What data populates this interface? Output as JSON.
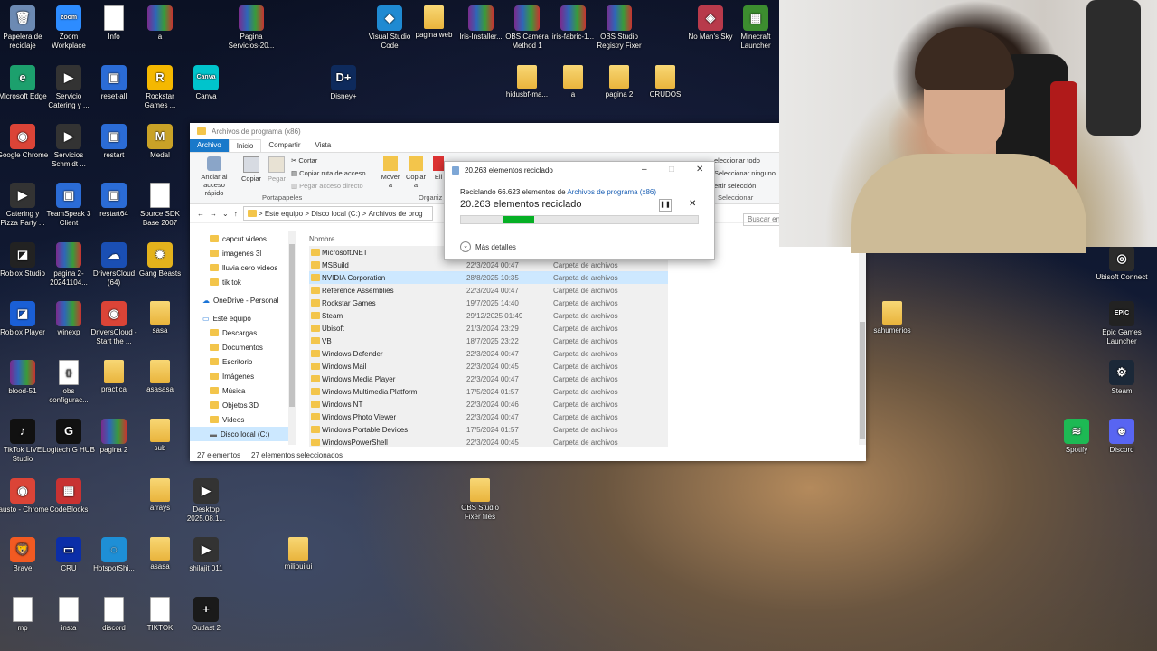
{
  "desktop_icons": [
    {
      "label": "Papelera de reciclaje",
      "glyph": "🗑",
      "kind": "app",
      "color": "#6c8ab3"
    },
    {
      "label": "Zoom Workplace",
      "glyph": "zoom",
      "kind": "app",
      "color": "#2d8cff"
    },
    {
      "label": "Info",
      "glyph": "",
      "kind": "doc",
      "color": "#ffffff"
    },
    {
      "label": "a",
      "glyph": "",
      "kind": "rar",
      "color": ""
    },
    {
      "label": "Pagina Servicios-20...",
      "glyph": "",
      "kind": "rar",
      "color": ""
    },
    {
      "label": "Visual Studio Code",
      "glyph": "◆",
      "kind": "app",
      "color": "#1f8ad2"
    },
    {
      "label": "pagina web",
      "glyph": "",
      "kind": "folder",
      "color": ""
    },
    {
      "label": "Iris-Installer...",
      "glyph": "",
      "kind": "rar",
      "color": ""
    },
    {
      "label": "OBS Camera Method 1",
      "glyph": "",
      "kind": "rar",
      "color": ""
    },
    {
      "label": "iris-fabric-1...",
      "glyph": "",
      "kind": "rar",
      "color": ""
    },
    {
      "label": "OBS Studio Registry Fixer",
      "glyph": "",
      "kind": "rar",
      "color": ""
    },
    {
      "label": "No Man's Sky",
      "glyph": "◈",
      "kind": "app",
      "color": "#b83a4b"
    },
    {
      "label": "Minecraft Launcher",
      "glyph": "▦",
      "kind": "app",
      "color": "#3c8d2f"
    },
    {
      "label": "Microsoft Edge",
      "glyph": "e",
      "kind": "app",
      "color": "#1ca06d"
    },
    {
      "label": "Servicio Catering y ...",
      "glyph": "▶",
      "kind": "app",
      "color": "#333333"
    },
    {
      "label": "reset-all",
      "glyph": "▣",
      "kind": "app",
      "color": "#2b6cd6"
    },
    {
      "label": "Rockstar Games ...",
      "glyph": "R",
      "kind": "app",
      "color": "#f5b800"
    },
    {
      "label": "Canva",
      "glyph": "Canva",
      "kind": "app",
      "color": "#00c4cc"
    },
    {
      "label": "Disney+",
      "glyph": "D+",
      "kind": "app",
      "color": "#0e2a5c"
    },
    {
      "label": "hidusbf-ma...",
      "glyph": "",
      "kind": "folder",
      "color": ""
    },
    {
      "label": "a",
      "glyph": "",
      "kind": "folder",
      "color": ""
    },
    {
      "label": "pagina 2",
      "glyph": "",
      "kind": "folder",
      "color": ""
    },
    {
      "label": "CRUDOS",
      "glyph": "",
      "kind": "folder",
      "color": ""
    },
    {
      "label": "Google Chrome",
      "glyph": "◉",
      "kind": "app",
      "color": "#db4437"
    },
    {
      "label": "Servicios Schmidt ...",
      "glyph": "▶",
      "kind": "app",
      "color": "#333333"
    },
    {
      "label": "restart",
      "glyph": "▣",
      "kind": "app",
      "color": "#2b6cd6"
    },
    {
      "label": "Medal",
      "glyph": "M",
      "kind": "app",
      "color": "#c9a227"
    },
    {
      "label": "Catering y Pizza Party ...",
      "glyph": "▶",
      "kind": "app",
      "color": "#333333"
    },
    {
      "label": "TeamSpeak 3 Client",
      "glyph": "▣",
      "kind": "app",
      "color": "#2b6cd6"
    },
    {
      "label": "restart64",
      "glyph": "▣",
      "kind": "app",
      "color": "#2b6cd6"
    },
    {
      "label": "Source SDK Base 2007",
      "glyph": "",
      "kind": "doc",
      "color": ""
    },
    {
      "label": "Roblox Studio",
      "glyph": "◪",
      "kind": "app",
      "color": "#222222"
    },
    {
      "label": "pagina 2-20241104...",
      "glyph": "",
      "kind": "rar",
      "color": ""
    },
    {
      "label": "DriversCloud (64)",
      "glyph": "☁",
      "kind": "app",
      "color": "#1a4fb4"
    },
    {
      "label": "Gang Beasts",
      "glyph": "✹",
      "kind": "app",
      "color": "#e3b21c"
    },
    {
      "label": "Roblox Player",
      "glyph": "◪",
      "kind": "app",
      "color": "#1a5fd6"
    },
    {
      "label": "winexp",
      "glyph": "",
      "kind": "rar",
      "color": ""
    },
    {
      "label": "DriversCloud - Start the ...",
      "glyph": "◉",
      "kind": "app",
      "color": "#db4437"
    },
    {
      "label": "sasa",
      "glyph": "",
      "kind": "folder",
      "color": ""
    },
    {
      "label": "blood-51",
      "glyph": "",
      "kind": "rar",
      "color": ""
    },
    {
      "label": "obs configurac...",
      "glyph": "{}",
      "kind": "doc",
      "color": ""
    },
    {
      "label": "practica",
      "glyph": "",
      "kind": "folder",
      "color": ""
    },
    {
      "label": "asasasa",
      "glyph": "",
      "kind": "folder",
      "color": ""
    },
    {
      "label": "TikTok LIVE Studio",
      "glyph": "♪",
      "kind": "app",
      "color": "#111111"
    },
    {
      "label": "Logitech G HUB",
      "glyph": "G",
      "kind": "app",
      "color": "#111111"
    },
    {
      "label": "pagina 2",
      "glyph": "",
      "kind": "rar",
      "color": ""
    },
    {
      "label": "sub",
      "glyph": "",
      "kind": "folder",
      "color": ""
    },
    {
      "label": "fausto - Chrome",
      "glyph": "◉",
      "kind": "app",
      "color": "#db4437"
    },
    {
      "label": "CodeBlocks",
      "glyph": "▦",
      "kind": "app",
      "color": "#c83232"
    },
    {
      "label": "arrays",
      "glyph": "",
      "kind": "folder",
      "color": ""
    },
    {
      "label": "Desktop 2025.08.1...",
      "glyph": "▶",
      "kind": "app",
      "color": "#333333"
    },
    {
      "label": "OBS Studio Fixer files",
      "glyph": "",
      "kind": "folder",
      "color": ""
    },
    {
      "label": "Brave",
      "glyph": "🦁",
      "kind": "app",
      "color": "#f25a22"
    },
    {
      "label": "CRU",
      "glyph": "▭",
      "kind": "app",
      "color": "#0b2ea8"
    },
    {
      "label": "HotspotShi...",
      "glyph": "◌",
      "kind": "app",
      "color": "#1e8fd6"
    },
    {
      "label": "asasa",
      "glyph": "",
      "kind": "folder",
      "color": ""
    },
    {
      "label": "shilajit 011",
      "glyph": "▶",
      "kind": "app",
      "color": "#333333"
    },
    {
      "label": "milipuilui",
      "glyph": "",
      "kind": "folder",
      "color": ""
    },
    {
      "label": "mp",
      "glyph": "",
      "kind": "doc",
      "color": ""
    },
    {
      "label": "insta",
      "glyph": "",
      "kind": "doc",
      "color": ""
    },
    {
      "label": "discord",
      "glyph": "",
      "kind": "doc",
      "color": ""
    },
    {
      "label": "TIKTOK",
      "glyph": "",
      "kind": "doc",
      "color": ""
    },
    {
      "label": "Outlast 2",
      "glyph": "+",
      "kind": "app",
      "color": "#1a1a1a"
    },
    {
      "label": "Ubisoft Connect",
      "glyph": "◎",
      "kind": "app",
      "color": "#2b2b2b"
    },
    {
      "label": "sahumerios",
      "glyph": "",
      "kind": "folder",
      "color": ""
    },
    {
      "label": "Epic Games Launcher",
      "glyph": "EPIC",
      "kind": "app",
      "color": "#222222"
    },
    {
      "label": "Steam",
      "glyph": "⚙",
      "kind": "app",
      "color": "#1b2838"
    },
    {
      "label": "Spotify",
      "glyph": "≋",
      "kind": "app",
      "color": "#1db954"
    },
    {
      "label": "Discord",
      "glyph": "☻",
      "kind": "app",
      "color": "#5865f2"
    }
  ],
  "explorer": {
    "title": "Archivos de programa (x86)",
    "tabs": [
      "Archivo",
      "Inicio",
      "Compartir",
      "Vista"
    ],
    "ribbon": {
      "pin": "Anclar al acceso rápido",
      "copy": "Copiar",
      "paste": "Pegar",
      "cut": "Cortar",
      "copy_path": "Copiar ruta de acceso",
      "paste_shortcut": "Pegar acceso directo",
      "clipboard_group": "Portapapeles",
      "move": "Mover a",
      "copy_to": "Copiar a",
      "delete": "Eli",
      "organize_group": "Organiz",
      "select_all": "eleccionar todo",
      "select_none": "Seleccionar ninguno",
      "invert": "ertir selección",
      "select_group": "Seleccionar"
    },
    "breadcrumbs": [
      "Este equipo",
      "Disco local (C:)",
      "Archivos de prog"
    ],
    "search_placeholder": "Buscar en A",
    "column_name": "Nombre",
    "nav": [
      {
        "label": "capcut videos",
        "kind": "folder"
      },
      {
        "label": "imagenes 3l",
        "kind": "folder"
      },
      {
        "label": "lluvia cero videos",
        "kind": "folder"
      },
      {
        "label": "tik tok",
        "kind": "folder"
      },
      {
        "label": "OneDrive - Personal",
        "kind": "cloud"
      },
      {
        "label": "Este equipo",
        "kind": "pc"
      },
      {
        "label": "Descargas",
        "kind": "folder"
      },
      {
        "label": "Documentos",
        "kind": "folder"
      },
      {
        "label": "Escritorio",
        "kind": "folder"
      },
      {
        "label": "Imágenes",
        "kind": "folder"
      },
      {
        "label": "Música",
        "kind": "folder"
      },
      {
        "label": "Objetos 3D",
        "kind": "folder"
      },
      {
        "label": "Videos",
        "kind": "folder"
      },
      {
        "label": "Disco local (C:)",
        "kind": "drive"
      }
    ],
    "files": [
      {
        "name": "Microsoft.NET",
        "date": "",
        "type": ""
      },
      {
        "name": "MSBuild",
        "date": "22/3/2024 00:47",
        "type": "Carpeta de archivos"
      },
      {
        "name": "NVIDIA Corporation",
        "date": "28/8/2025 10:35",
        "type": "Carpeta de archivos"
      },
      {
        "name": "Reference Assemblies",
        "date": "22/3/2024 00:47",
        "type": "Carpeta de archivos"
      },
      {
        "name": "Rockstar Games",
        "date": "19/7/2025 14:40",
        "type": "Carpeta de archivos"
      },
      {
        "name": "Steam",
        "date": "29/12/2025 01:49",
        "type": "Carpeta de archivos"
      },
      {
        "name": "Ubisoft",
        "date": "21/3/2024 23:29",
        "type": "Carpeta de archivos"
      },
      {
        "name": "VB",
        "date": "18/7/2025 23:22",
        "type": "Carpeta de archivos"
      },
      {
        "name": "Windows Defender",
        "date": "22/3/2024 00:47",
        "type": "Carpeta de archivos"
      },
      {
        "name": "Windows Mail",
        "date": "22/3/2024 00:45",
        "type": "Carpeta de archivos"
      },
      {
        "name": "Windows Media Player",
        "date": "22/3/2024 00:47",
        "type": "Carpeta de archivos"
      },
      {
        "name": "Windows Multimedia Platform",
        "date": "17/5/2024 01:57",
        "type": "Carpeta de archivos"
      },
      {
        "name": "Windows NT",
        "date": "22/3/2024 00:46",
        "type": "Carpeta de archivos"
      },
      {
        "name": "Windows Photo Viewer",
        "date": "22/3/2024 00:47",
        "type": "Carpeta de archivos"
      },
      {
        "name": "Windows Portable Devices",
        "date": "17/5/2024 01:57",
        "type": "Carpeta de archivos"
      },
      {
        "name": "WindowsPowerShell",
        "date": "22/3/2024 00:45",
        "type": "Carpeta de archivos"
      }
    ],
    "status_count": "27 elementos",
    "status_selected": "27 elementos seleccionados"
  },
  "dialog": {
    "title": "20.263 elementos reciclado",
    "line_prefix": "Reciclando 66.623 elementos de ",
    "line_link": "Archivos de programa (x86)",
    "big": "20.263 elementos reciclado",
    "progress": 0.31,
    "more": "Más detalles"
  }
}
